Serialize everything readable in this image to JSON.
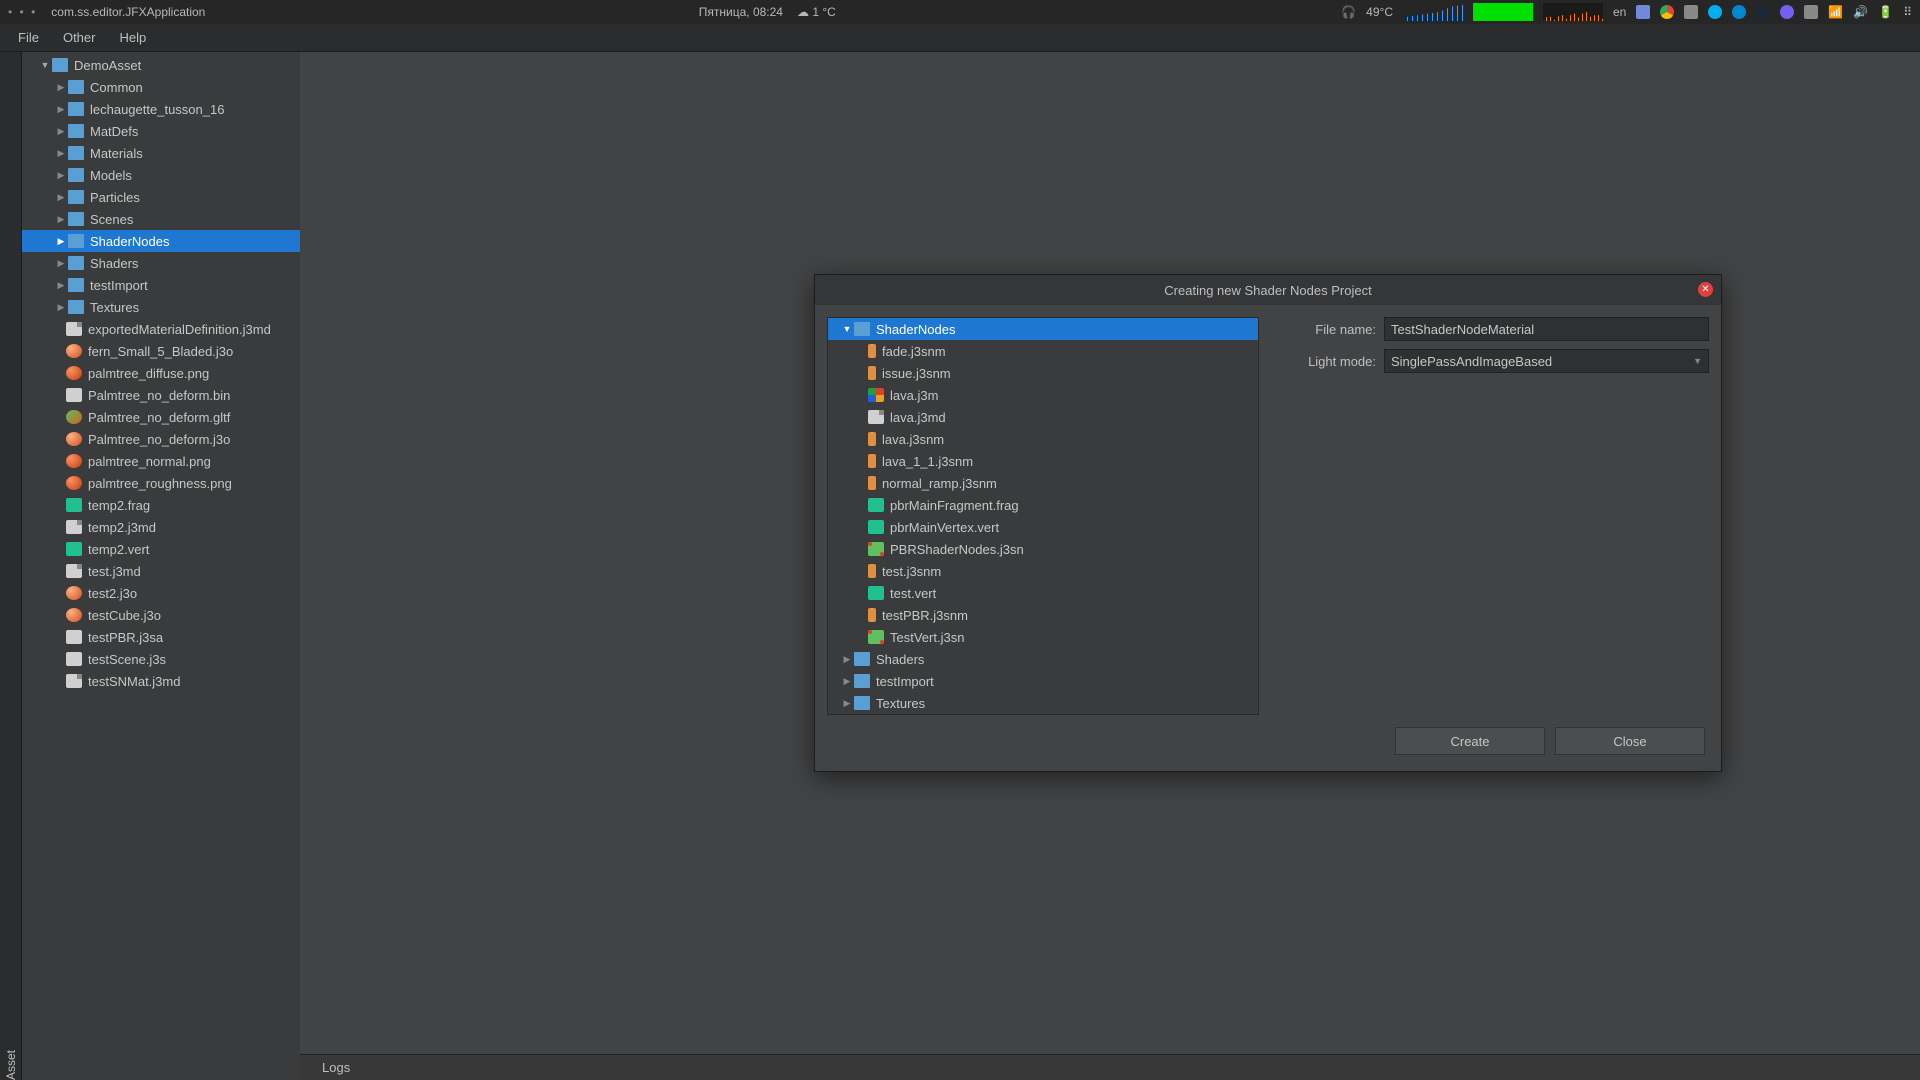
{
  "osbar": {
    "app_indicator": "• • •",
    "title": "com.ss.editor.JFXApplication",
    "date": "Пятница, 08:24",
    "weather": "☁  1 °C",
    "temp": "49°C",
    "lang": "en",
    "headphones": "🎧"
  },
  "menu": {
    "file": "File",
    "other": "Other",
    "help": "Help"
  },
  "sidetab": "Asset",
  "tree": {
    "root": "DemoAsset",
    "folders": [
      "Common",
      "lechaugette_tusson_16",
      "MatDefs",
      "Materials",
      "Models",
      "Particles",
      "Scenes"
    ],
    "selected": "ShaderNodes",
    "folders2": [
      "Shaders",
      "testImport",
      "Textures"
    ],
    "files": [
      {
        "n": "exportedMaterialDefinition.j3md",
        "ic": "ic-md"
      },
      {
        "n": "fern_Small_5_Bladed.j3o",
        "ic": "ic-3d"
      },
      {
        "n": "palmtree_diffuse.png",
        "ic": "ic-png"
      },
      {
        "n": "Palmtree_no_deform.bin",
        "ic": "ic-bin"
      },
      {
        "n": "Palmtree_no_deform.gltf",
        "ic": "ic-gltf"
      },
      {
        "n": "Palmtree_no_deform.j3o",
        "ic": "ic-3d"
      },
      {
        "n": "palmtree_normal.png",
        "ic": "ic-png"
      },
      {
        "n": "palmtree_roughness.png",
        "ic": "ic-png"
      },
      {
        "n": "temp2.frag",
        "ic": "ic-frag"
      },
      {
        "n": "temp2.j3md",
        "ic": "ic-md"
      },
      {
        "n": "temp2.vert",
        "ic": "ic-vert"
      },
      {
        "n": "test.j3md",
        "ic": "ic-md"
      },
      {
        "n": "test2.j3o",
        "ic": "ic-3d"
      },
      {
        "n": "testCube.j3o",
        "ic": "ic-3d"
      },
      {
        "n": "testPBR.j3sa",
        "ic": "ic-j3sa"
      },
      {
        "n": "testScene.j3s",
        "ic": "ic-j3s"
      },
      {
        "n": "testSNMat.j3md",
        "ic": "ic-md"
      }
    ]
  },
  "logs": "Logs",
  "dialog": {
    "title": "Creating new Shader Nodes Project",
    "tree_root": "ShaderNodes",
    "tree_files": [
      {
        "n": "fade.j3snm",
        "ic": "ic-snm"
      },
      {
        "n": "issue.j3snm",
        "ic": "ic-snm"
      },
      {
        "n": "lava.j3m",
        "ic": "ic-j3m"
      },
      {
        "n": "lava.j3md",
        "ic": "ic-md"
      },
      {
        "n": "lava.j3snm",
        "ic": "ic-snm"
      },
      {
        "n": "lava_1_1.j3snm",
        "ic": "ic-snm"
      },
      {
        "n": "normal_ramp.j3snm",
        "ic": "ic-snm"
      },
      {
        "n": "pbrMainFragment.frag",
        "ic": "ic-frag"
      },
      {
        "n": "pbrMainVertex.vert",
        "ic": "ic-vert"
      },
      {
        "n": "PBRShaderNodes.j3sn",
        "ic": "ic-j3sn"
      },
      {
        "n": "test.j3snm",
        "ic": "ic-snm"
      },
      {
        "n": "test.vert",
        "ic": "ic-vert"
      },
      {
        "n": "testPBR.j3snm",
        "ic": "ic-snm"
      },
      {
        "n": "TestVert.j3sn",
        "ic": "ic-j3sn"
      }
    ],
    "tree_folders2": [
      "Shaders",
      "testImport",
      "Textures"
    ],
    "filename_label": "File name:",
    "filename_value": "TestShaderNodeMaterial",
    "lightmode_label": "Light mode:",
    "lightmode_value": "SinglePassAndImageBased",
    "create": "Create",
    "close": "Close"
  }
}
